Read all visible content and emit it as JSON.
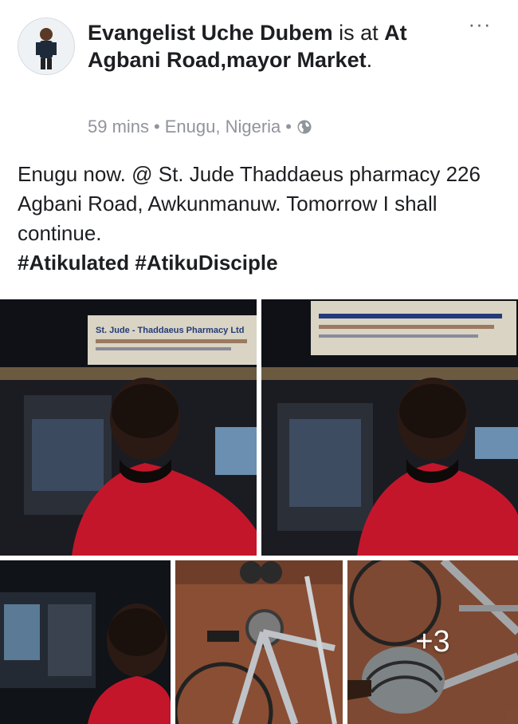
{
  "post": {
    "author": "Evangelist Uche Dubem",
    "checkin_connector": "is at",
    "place": "At Agbani Road,mayor Market",
    "place_suffix": ".",
    "time": "59 mins",
    "location": "Enugu, Nigeria",
    "separator": "•",
    "privacy_icon": "globe-icon",
    "more_label": "···",
    "body_text": "Enugu now. @ St. Jude Thaddaeus pharmacy 226 Agbani Road, Awkunmanuw. Tomorrow I shall continue.",
    "hashtags": "#Atikulated #AtikuDisciple"
  },
  "photos": {
    "sign_text": "St. Jude - Thaddaeus Pharmacy Ltd",
    "more_count": "+3"
  },
  "colors": {
    "text_primary": "#1c1e21",
    "text_secondary": "#90949c",
    "hoodie_red": "#c4162a"
  }
}
